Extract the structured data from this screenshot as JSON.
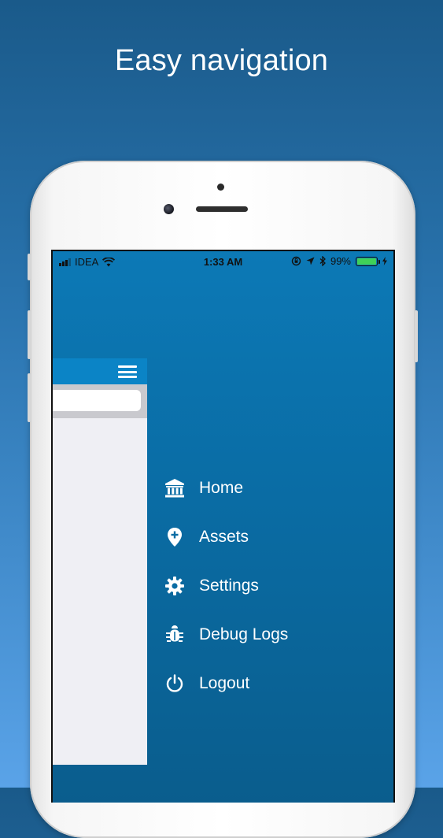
{
  "headline": "Easy navigation",
  "status_bar": {
    "carrier": "IDEA",
    "time": "1:33 AM",
    "battery_percent": "99%",
    "battery_level": 0.99,
    "battery_color": "#3fd158"
  },
  "app_panel": {
    "header_color": "#0b84c6",
    "menu_icon": "hamburger-icon",
    "search_value": ""
  },
  "menu": {
    "items": [
      {
        "label": "Home",
        "icon": "bank-icon"
      },
      {
        "label": "Assets",
        "icon": "location-pin-plus-icon"
      },
      {
        "label": "Settings",
        "icon": "gear-icon"
      },
      {
        "label": "Debug Logs",
        "icon": "bug-icon"
      },
      {
        "label": "Logout",
        "icon": "power-icon"
      }
    ]
  },
  "colors": {
    "page_gradient_top": "#1a5a8a",
    "page_gradient_bottom": "#5aa3e8",
    "drawer_background": "#0a6ca4"
  }
}
